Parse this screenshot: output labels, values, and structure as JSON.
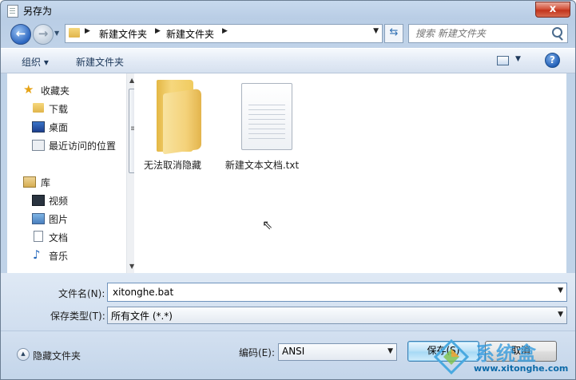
{
  "window": {
    "title": "另存为",
    "close_glyph": "x"
  },
  "address": {
    "back_glyph": "←",
    "forward_glyph": "→",
    "crumbs": [
      "新建文件夹",
      "新建文件夹"
    ],
    "search_placeholder": "搜索 新建文件夹"
  },
  "toolbar": {
    "organize_label": "组织 ▾",
    "new_folder_label": "新建文件夹",
    "help_glyph": "?"
  },
  "sidebar": {
    "favorites_label": "收藏夹",
    "favorites": [
      "下载",
      "桌面",
      "最近访问的位置"
    ],
    "libraries_label": "库",
    "libraries": [
      "视频",
      "图片",
      "文档",
      "音乐"
    ]
  },
  "files": [
    {
      "name": "无法取消隐藏",
      "icon": "folder-icon"
    },
    {
      "name": "新建文本文档.txt",
      "icon": "text-file-icon"
    }
  ],
  "form": {
    "filename_label": "文件名(N):",
    "filename_value": "xitonghe.bat",
    "filetype_label": "保存类型(T):",
    "filetype_value": "所有文件 (*.*)"
  },
  "bottom": {
    "hide_folders_label": "隐藏文件夹",
    "encoding_label": "编码(E):",
    "encoding_value": "ANSI",
    "save_label": "保存(S)",
    "cancel_label": "取消"
  },
  "watermark": {
    "brand": "系统盒",
    "url": "www.xitonghe.com"
  },
  "colors": {
    "window_frame": "#c7d9ee",
    "save_accent": "#3c7fb1",
    "close_red": "#c2341c",
    "watermark_blue": "#2896dc"
  }
}
